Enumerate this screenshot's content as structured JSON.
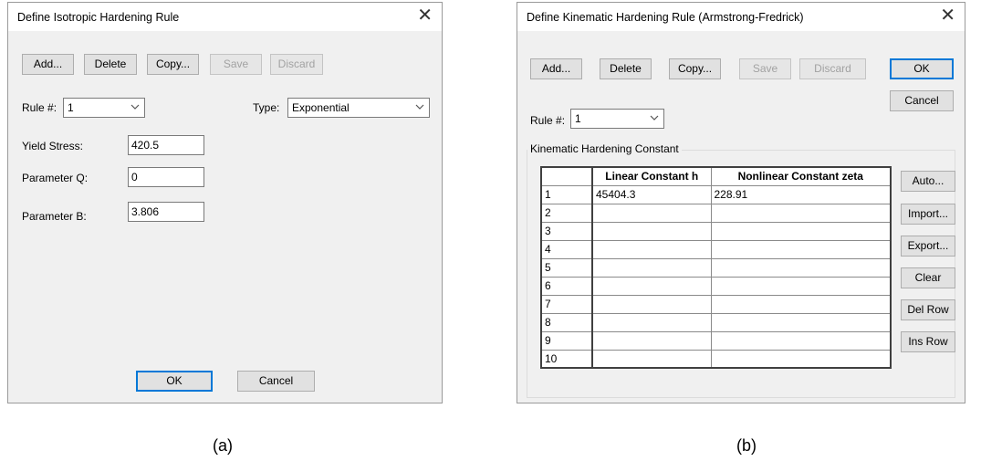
{
  "isotropic_dialog": {
    "title": "Define Isotropic Hardening Rule",
    "buttons": {
      "add": "Add...",
      "delete": "Delete",
      "copy": "Copy...",
      "save": "Save",
      "discard": "Discard",
      "ok": "OK",
      "cancel": "Cancel"
    },
    "rule_label": "Rule #:",
    "rule_value": "1",
    "type_label": "Type:",
    "type_value": "Exponential",
    "fields": [
      {
        "label": "Yield Stress:",
        "value": "420.5"
      },
      {
        "label": "Parameter Q:",
        "value": "0"
      },
      {
        "label": "Parameter B:",
        "value": "3.806"
      }
    ],
    "close_icon": "close-icon"
  },
  "kinematic_dialog": {
    "title": "Define Kinematic Hardening Rule (Armstrong-Fredrick)",
    "buttons": {
      "add": "Add...",
      "delete": "Delete",
      "copy": "Copy...",
      "save": "Save",
      "discard": "Discard",
      "ok": "OK",
      "cancel": "Cancel"
    },
    "rule_label": "Rule #:",
    "rule_value": "1",
    "group_title": "Kinematic Hardening Constant",
    "table": {
      "columns": [
        "Linear Constant h",
        "Nonlinear Constant zeta"
      ],
      "rows": [
        {
          "num": "1",
          "h": "45404.3",
          "zeta": "228.91"
        },
        {
          "num": "2",
          "h": "",
          "zeta": ""
        },
        {
          "num": "3",
          "h": "",
          "zeta": ""
        },
        {
          "num": "4",
          "h": "",
          "zeta": ""
        },
        {
          "num": "5",
          "h": "",
          "zeta": ""
        },
        {
          "num": "6",
          "h": "",
          "zeta": ""
        },
        {
          "num": "7",
          "h": "",
          "zeta": ""
        },
        {
          "num": "8",
          "h": "",
          "zeta": ""
        },
        {
          "num": "9",
          "h": "",
          "zeta": ""
        },
        {
          "num": "10",
          "h": "",
          "zeta": ""
        }
      ]
    },
    "side_buttons": {
      "auto": "Auto...",
      "import": "Import...",
      "export": "Export...",
      "clear": "Clear",
      "del_row": "Del Row",
      "ins_row": "Ins Row"
    },
    "close_icon": "close-icon"
  },
  "captions": {
    "a": "(a)",
    "b": "(b)"
  },
  "colors": {
    "dialog_bg": "#f0f0f0",
    "title_bg": "#ffffff",
    "default_button_border": "#0078d7",
    "disabled_text": "#a2a2a2"
  }
}
